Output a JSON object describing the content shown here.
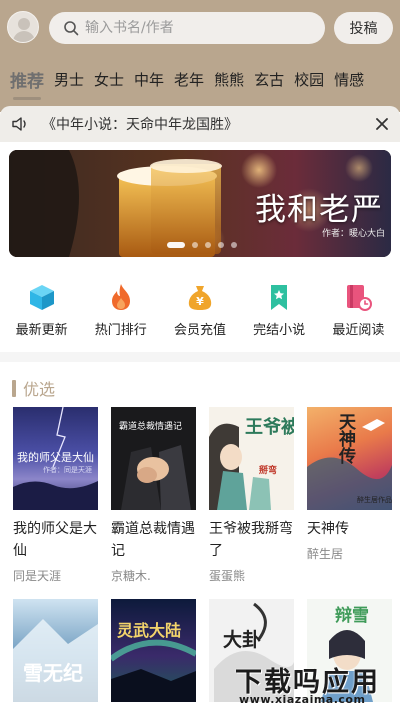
{
  "header": {
    "search_placeholder": "输入书名/作者",
    "post_label": "投稿"
  },
  "tabs": [
    {
      "label": "推荐",
      "active": true
    },
    {
      "label": "男士"
    },
    {
      "label": "女士"
    },
    {
      "label": "中年"
    },
    {
      "label": "老年"
    },
    {
      "label": "熊熊"
    },
    {
      "label": "玄古"
    },
    {
      "label": "校园"
    },
    {
      "label": "情感"
    }
  ],
  "notice": {
    "text": "《中年小说：天命中年龙国胜》"
  },
  "banner": {
    "title": "我和老严",
    "author": "作者：暖心大白",
    "slide_count": 5,
    "active_slide": 1
  },
  "quick_entries": [
    {
      "label": "最新更新",
      "icon": "cube-icon",
      "color": "#2fb6e6"
    },
    {
      "label": "热门排行",
      "icon": "flame-icon",
      "color": "#f06a2b"
    },
    {
      "label": "会员充值",
      "icon": "money-bag-icon",
      "color": "#f0a52b"
    },
    {
      "label": "完结小说",
      "icon": "bookmark-icon",
      "color": "#2ec0a0"
    },
    {
      "label": "最近阅读",
      "icon": "book-clock-icon",
      "color": "#e9547d"
    }
  ],
  "section": {
    "title": "优选"
  },
  "books": [
    {
      "title": "我的师父是大仙",
      "author": "同是天涯",
      "cover_title": "我的师父是大仙",
      "cover_sub": "作者：同是天涯"
    },
    {
      "title": "霸道总裁情遇记",
      "author": "京糖木.",
      "cover_title": "霸道总裁情遇记"
    },
    {
      "title": "王爷被我掰弯了",
      "author": "蛋蛋熊",
      "cover_title": "王爷被我",
      "cover_sub": "掰弯"
    },
    {
      "title": "天神传",
      "author": "醉生居",
      "cover_title": "天神传",
      "cover_sub": "醉生居作品"
    },
    {
      "title": "",
      "author": "",
      "cover_title": "雪无纪"
    },
    {
      "title": "",
      "author": "",
      "cover_title": "灵武大陆"
    },
    {
      "title": "",
      "author": "",
      "cover_title": "大卦"
    },
    {
      "title": "",
      "author": "",
      "cover_title": "辩雪"
    }
  ],
  "watermark": {
    "main": "下载吗应用",
    "sub": "www.xiazaima.com"
  },
  "colors": {
    "brand": "#b9a68e",
    "search_bg": "#f1eeeb",
    "notice_bg": "#efede9"
  }
}
